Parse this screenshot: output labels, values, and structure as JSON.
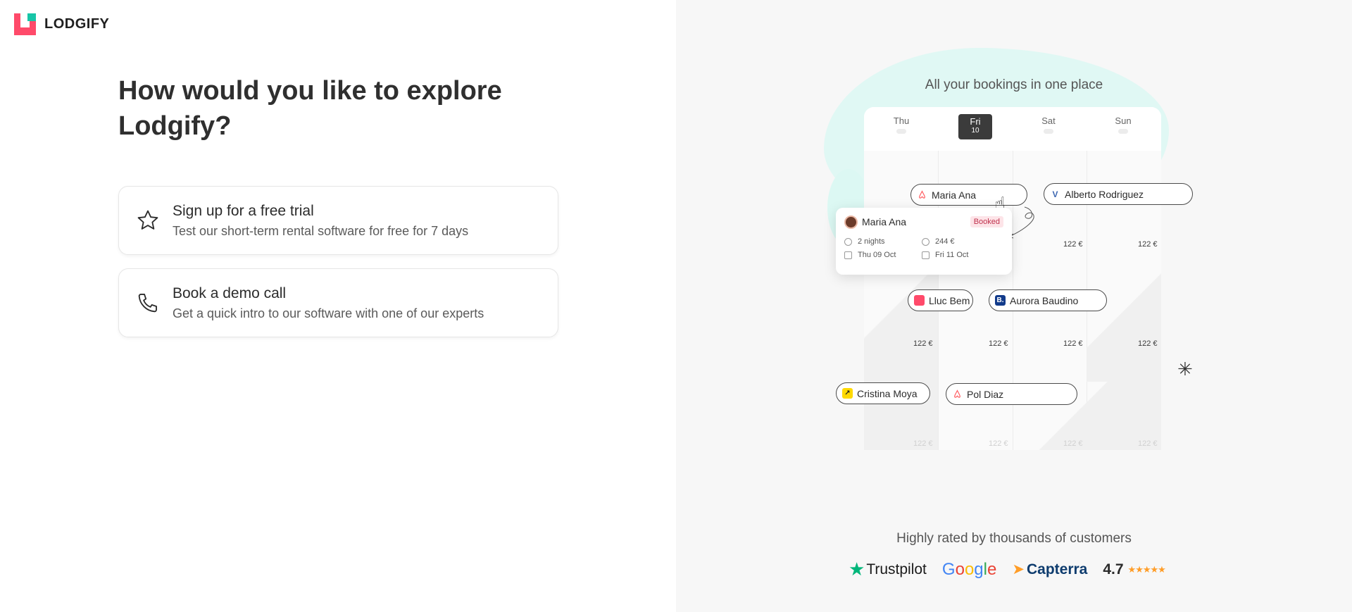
{
  "brand": {
    "name": "LODGIFY"
  },
  "heading": "How would you like to explore Lodgify?",
  "options": [
    {
      "title": "Sign up for a free trial",
      "subtitle": "Test our short-term rental software for free for 7 days",
      "icon": "star-icon"
    },
    {
      "title": "Book a demo call",
      "subtitle": "Get a quick intro to our software with one of our experts",
      "icon": "phone-icon"
    }
  ],
  "calendar": {
    "title": "All your bookings in one place",
    "days": [
      {
        "label": "Thu",
        "num": ""
      },
      {
        "label": "Fri",
        "num": "10"
      },
      {
        "label": "Sat",
        "num": ""
      },
      {
        "label": "Sun",
        "num": ""
      }
    ],
    "price": "122 €",
    "bookings": {
      "maria_top": "Maria Ana",
      "alberto": "Alberto Rodriguez",
      "lluc": "Lluc Bem",
      "aurora": "Aurora Baudino",
      "cristina": "Cristina Moya",
      "pol": "Pol Diaz"
    },
    "card": {
      "name": "Maria Ana",
      "status": "Booked",
      "nights": "2 nights",
      "amount": "244 €",
      "checkin": "Thu 09 Oct",
      "checkout": "Fri 11 Oct"
    }
  },
  "reviews": {
    "title": "Highly rated by thousands of customers",
    "trustpilot": "Trustpilot",
    "google": "Google",
    "capterra": "Capterra",
    "score": "4.7",
    "stars": "★★★★★"
  },
  "colors": {
    "brand_red": "#ff4a6a",
    "brand_teal": "#18c5a7",
    "accent_mint": "#dcf8f3"
  }
}
